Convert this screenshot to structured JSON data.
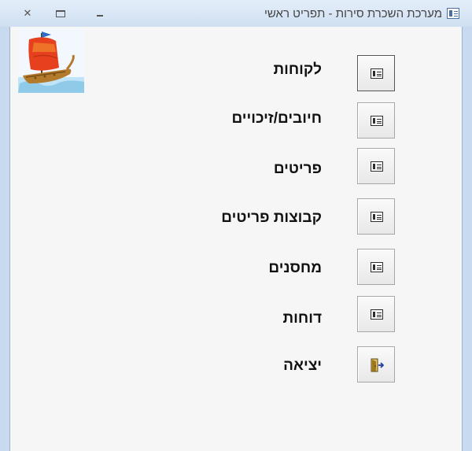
{
  "window": {
    "title": "מערכת השכרת סירות - תפריט ראשי",
    "controls": [
      "close",
      "maximize",
      "minimize"
    ]
  },
  "logo": {
    "icon": "sailboat-icon"
  },
  "menu": [
    {
      "id": "customers",
      "label": "לקוחות",
      "icon": "form-icon"
    },
    {
      "id": "charges-credits",
      "label": "חיובים/זיכויים",
      "icon": "form-icon"
    },
    {
      "id": "items",
      "label": "פריטים",
      "icon": "form-icon"
    },
    {
      "id": "item-groups",
      "label": "קבוצות פריטים",
      "icon": "form-icon"
    },
    {
      "id": "warehouses",
      "label": "מחסנים",
      "icon": "form-icon"
    },
    {
      "id": "reports",
      "label": "דוחות",
      "icon": "form-icon"
    },
    {
      "id": "exit",
      "label": "יציאה",
      "icon": "exit-door-icon"
    }
  ]
}
